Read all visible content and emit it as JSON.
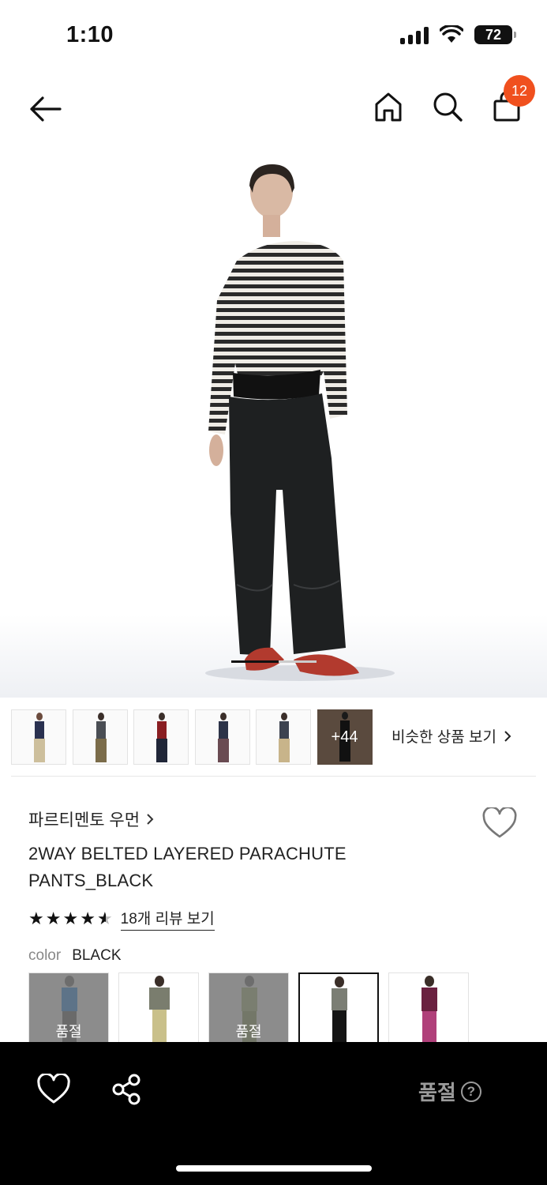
{
  "status_bar": {
    "time": "1:10",
    "battery": "72",
    "icons": [
      "signal-icon",
      "wifi-icon",
      "battery-icon"
    ]
  },
  "nav": {
    "icons": [
      "back-arrow-icon",
      "home-icon",
      "search-icon",
      "shopping-bag-icon"
    ],
    "cart_count": "12"
  },
  "hero": {
    "image": "model-full-body-striped-top-black-parachute-pants",
    "pager_current": 1
  },
  "thumbnails": {
    "more_label": "+44",
    "similar_label": "비슷한 상품 보기",
    "items": [
      "navy-vest-beige-pants",
      "grey-top-khaki-pants",
      "red-top-navy-pants",
      "navy-top-brown-pants",
      "grey-vest-beige-pants",
      "black-outfit"
    ]
  },
  "product": {
    "brand": "파르티멘토 우먼",
    "name_line1": "2WAY BELTED LAYERED PARACHUTE",
    "name_line2": "PANTS_BLACK",
    "rating": 4.5,
    "review_link": "18개 리뷰 보기",
    "color_label": "color",
    "color_value": "BLACK",
    "sold_out_label": "품절"
  },
  "swatches": [
    {
      "name": "blue-grey",
      "sold_out": true
    },
    {
      "name": "khaki",
      "sold_out": false
    },
    {
      "name": "olive",
      "sold_out": true
    },
    {
      "name": "black",
      "sold_out": false,
      "selected": true
    },
    {
      "name": "magenta",
      "sold_out": false
    }
  ],
  "bottom_bar": {
    "status": "품절",
    "help": "?"
  },
  "colors": {
    "badge": "#f0501e",
    "bottom_bar": "#000000",
    "soldout_text": "#9b9b9b"
  }
}
